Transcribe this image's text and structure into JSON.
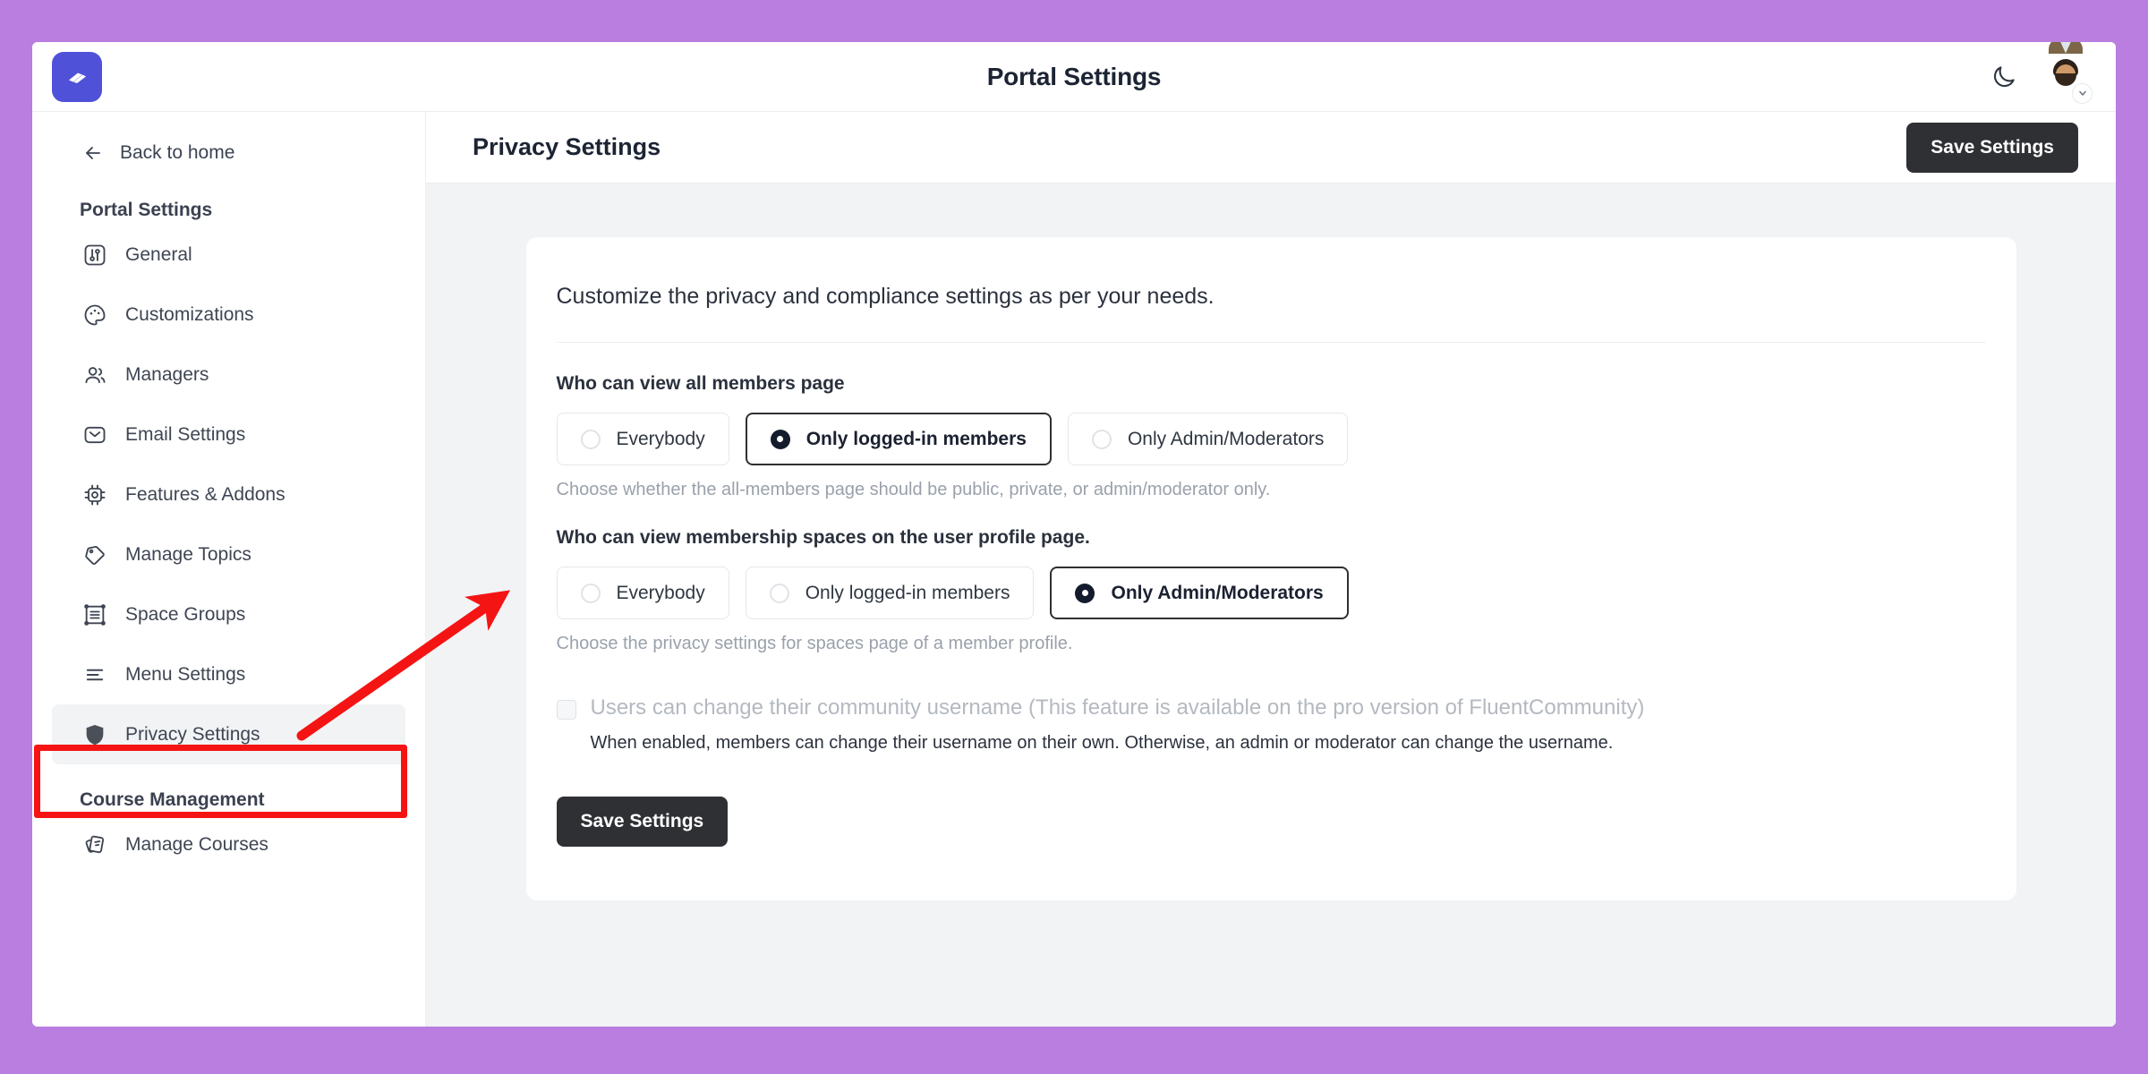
{
  "topbar": {
    "title": "Portal Settings",
    "brand_logo_icon": "fluent-community-logo-icon",
    "dark_mode_icon": "moon-icon",
    "avatar_icon": "user-avatar",
    "avatar_chevron_icon": "chevron-down-icon",
    "brand_color": "#4f51d8"
  },
  "sidebar": {
    "back_label": "Back to home",
    "back_icon": "arrow-left-icon",
    "groups": [
      {
        "title": "Portal Settings",
        "items": [
          {
            "label": "General",
            "icon": "sliders-icon",
            "active": false
          },
          {
            "label": "Customizations",
            "icon": "palette-icon",
            "active": false
          },
          {
            "label": "Managers",
            "icon": "users-icon",
            "active": false
          },
          {
            "label": "Email Settings",
            "icon": "envelope-icon",
            "active": false
          },
          {
            "label": "Features & Addons",
            "icon": "chip-icon",
            "active": false
          },
          {
            "label": "Manage Topics",
            "icon": "tag-icon",
            "active": false
          },
          {
            "label": "Space Groups",
            "icon": "layout-grid-icon",
            "active": false
          },
          {
            "label": "Menu Settings",
            "icon": "menu-lines-icon",
            "active": false
          },
          {
            "label": "Privacy Settings",
            "icon": "shield-icon",
            "active": true
          }
        ]
      },
      {
        "title": "Course Management",
        "items": [
          {
            "label": "Manage Courses",
            "icon": "cards-icon",
            "active": false
          }
        ]
      }
    ]
  },
  "main": {
    "page_title": "Privacy Settings",
    "header_save_label": "Save Settings",
    "card": {
      "intro": "Customize the privacy and compliance settings as per your needs.",
      "fields": [
        {
          "label": "Who can view all members page",
          "options": [
            {
              "label": "Everybody",
              "selected": false
            },
            {
              "label": "Only logged-in members",
              "selected": true
            },
            {
              "label": "Only Admin/Moderators",
              "selected": false
            }
          ],
          "help": "Choose whether the all-members page should be public, private, or admin/moderator only."
        },
        {
          "label": "Who can view membership spaces on the user profile page.",
          "options": [
            {
              "label": "Everybody",
              "selected": false
            },
            {
              "label": "Only logged-in members",
              "selected": false
            },
            {
              "label": "Only Admin/Moderators",
              "selected": true
            }
          ],
          "help": "Choose the privacy settings for spaces page of a member profile."
        }
      ],
      "checkbox": {
        "label": "Users can change their community username (This feature is available on the pro version of FluentCommunity)",
        "help": "When enabled, members can change their username on their own. Otherwise, an admin or moderator can change the username.",
        "checked": false,
        "disabled": true
      },
      "save_label": "Save Settings"
    }
  },
  "annotations": {
    "highlight_color": "#f51414",
    "highlight_target": "Privacy Settings",
    "arrow_target": "privacy-settings-content"
  }
}
